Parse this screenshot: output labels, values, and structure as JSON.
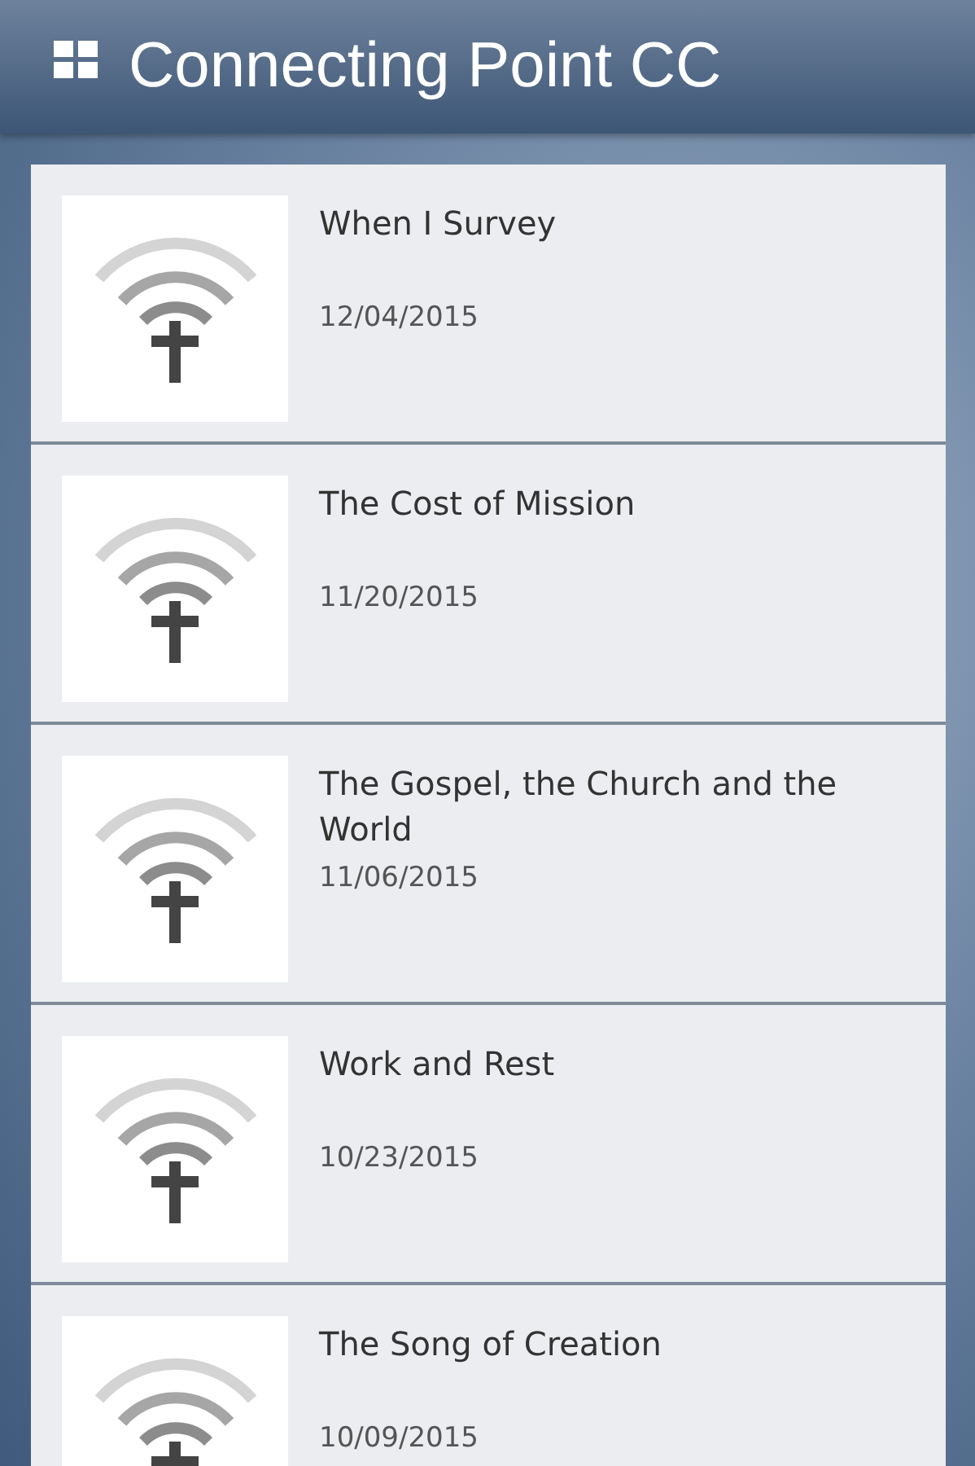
{
  "app_bar": {
    "title": "Connecting Point CC"
  },
  "sermons": [
    {
      "title": "When I Survey",
      "date": "12/04/2015"
    },
    {
      "title": "The Cost of Mission",
      "date": "11/20/2015"
    },
    {
      "title": "The Gospel, the Church and the World",
      "date": "11/06/2015"
    },
    {
      "title": "Work and Rest",
      "date": "10/23/2015"
    },
    {
      "title": "The Song of Creation",
      "date": "10/09/2015"
    }
  ]
}
